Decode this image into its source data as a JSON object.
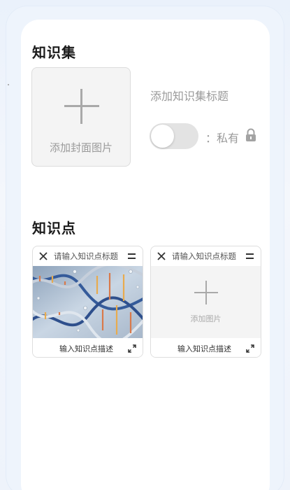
{
  "sections": {
    "knowledge_set": "知识集",
    "knowledge_points": "知识点"
  },
  "cover": {
    "label": "添加封面图片"
  },
  "set": {
    "title_placeholder": "添加知识集标题",
    "privacy_separator": "：",
    "privacy_label": "私有",
    "is_public": false
  },
  "points": [
    {
      "title_placeholder": "请输入知识点标题",
      "desc_placeholder": "输入知识点描述",
      "has_image": true
    },
    {
      "title_placeholder": "请输入知识点标题",
      "desc_placeholder": "输入知识点描述",
      "has_image": false,
      "add_image_label": "添加图片"
    }
  ],
  "icons": {
    "plus": "plus-icon",
    "lock": "lock-icon",
    "close": "close-icon",
    "menu": "drag-handle-icon",
    "expand": "expand-icon"
  }
}
